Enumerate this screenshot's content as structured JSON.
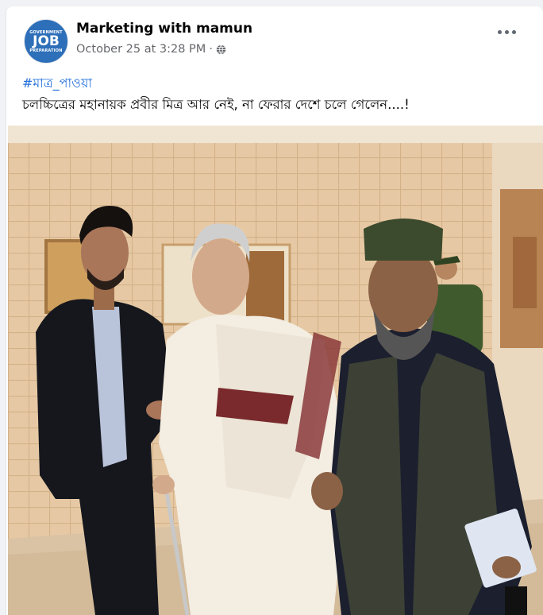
{
  "post": {
    "avatar": {
      "line1": "GOVERNMENT",
      "line2": "JOB",
      "line3": "PREPARATION",
      "color": "#2d6fb9"
    },
    "author": "Marketing with mamun",
    "timestamp": "October 25 at 3:28 PM",
    "separator": "·",
    "privacy_icon": "globe-icon",
    "more_icon": "more-options-icon",
    "hashtag": "#মাত্র_পাওয়া",
    "text": "চলচ্চিত্রের মহানায়ক প্রবীর মিত্র আর নেই, না ফেরার দেশে চলে গেলেন....!",
    "colors": {
      "link": "#216fdb",
      "meta": "#65676b",
      "text": "#050505"
    }
  }
}
